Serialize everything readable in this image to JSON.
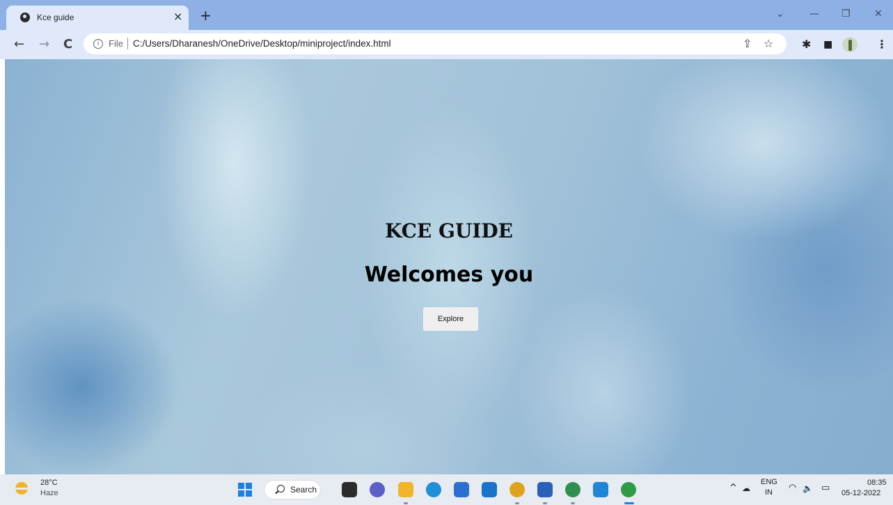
{
  "tab": {
    "title": "Kce guide",
    "close_glyph": "×",
    "favicon": "globe-icon"
  },
  "new_tab_glyph": "+",
  "window_controls": {
    "dropdown": "⌄",
    "minimize": "—",
    "restore": "❐",
    "close": "✕"
  },
  "nav": {
    "back": "←",
    "forward": "→",
    "reload": "C"
  },
  "omnibox": {
    "info_glyph": "i",
    "scheme_label": "File",
    "url": "C:/Users/Dharanesh/OneDrive/Desktop/miniproject/index.html",
    "share_glyph": "⇪",
    "bookmark_glyph": "☆"
  },
  "toolbar_icons": {
    "extensions": "✱",
    "side_panel": "■",
    "menu": "⋮"
  },
  "page": {
    "brand": "KCE GUIDE",
    "welcome": "Welcomes you",
    "explore_button": "Explore"
  },
  "taskbar": {
    "weather_temp": "28°C",
    "weather_condition": "Haze",
    "search_label": "Search",
    "tray_chevron": "^",
    "lang_line1": "ENG",
    "lang_line2": "IN",
    "wifi": "◠",
    "volume": "🔈",
    "battery": "▭",
    "time": "08:35",
    "date": "05-12-2022",
    "apps": [
      {
        "name": "task-view",
        "color": "#2b2b2b"
      },
      {
        "name": "chat",
        "color": "#5b5fc7"
      },
      {
        "name": "file-explorer",
        "color": "#f2b52a"
      },
      {
        "name": "edge",
        "color": "#1f8fd6"
      },
      {
        "name": "store",
        "color": "#2b6fd1"
      },
      {
        "name": "camera",
        "color": "#1b73c9"
      },
      {
        "name": "chrome-beta",
        "color": "#e0a21b"
      },
      {
        "name": "word",
        "color": "#2b5fb8"
      },
      {
        "name": "chrome-dev",
        "color": "#2f8f4f"
      },
      {
        "name": "vscode",
        "color": "#1f86d6"
      },
      {
        "name": "chrome",
        "color": "#2f9b46"
      }
    ]
  }
}
